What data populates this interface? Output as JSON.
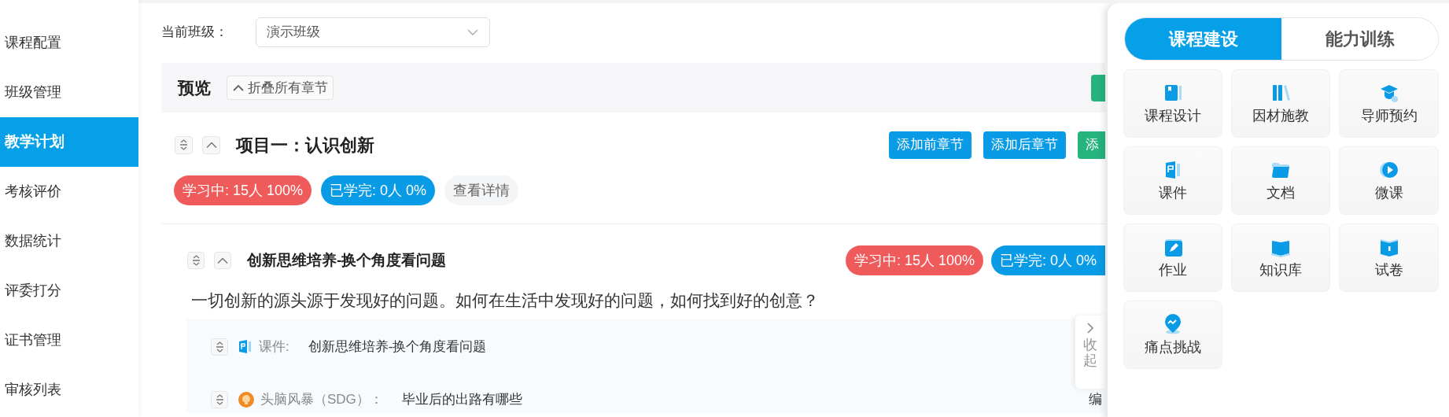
{
  "sidebar": {
    "items": [
      {
        "label": "课程配置",
        "selected": false
      },
      {
        "label": "班级管理",
        "selected": false
      },
      {
        "label": "教学计划",
        "selected": true
      },
      {
        "label": "考核评价",
        "selected": false
      },
      {
        "label": "数据统计",
        "selected": false
      },
      {
        "label": "评委打分",
        "selected": false
      },
      {
        "label": "证书管理",
        "selected": false
      },
      {
        "label": "审核列表",
        "selected": false
      }
    ]
  },
  "class_selector": {
    "label": "当前班级：",
    "value": "演示班级"
  },
  "preview": {
    "title": "预览",
    "collapse_all": "折叠所有章节"
  },
  "chapter": {
    "title": "项目一：认识创新",
    "buttons": [
      {
        "label": "添加前章节",
        "kind": "blue"
      },
      {
        "label": "添加后章节",
        "kind": "blue"
      },
      {
        "label": "添",
        "kind": "green"
      }
    ],
    "badges": [
      {
        "label": "学习中: 15人 100%",
        "kind": "learning"
      },
      {
        "label": "已学完: 0人 0%",
        "kind": "done"
      },
      {
        "label": "查看详情",
        "kind": "details"
      }
    ]
  },
  "section": {
    "title": "创新思维培养-换个角度看问题",
    "badges": [
      {
        "label": "学习中: 15人 100%",
        "kind": "learning"
      },
      {
        "label": "已学完: 0人 0%",
        "kind": "done"
      }
    ],
    "description": "一切创新的源头源于发现好的问题。如何在生活中发现好的问题，如何找到好的创意？",
    "resources": [
      {
        "kind": "courseware",
        "type_label": "课件:",
        "title": "创新思维培养-换个角度看问题"
      },
      {
        "kind": "brainstorm",
        "type_label": "头脑风暴（SDG）：",
        "title": "毕业后的出路有哪些",
        "action": "编"
      }
    ]
  },
  "collapse_tab": {
    "label": "收起"
  },
  "panel": {
    "tabs": [
      {
        "label": "课程建设",
        "selected": true
      },
      {
        "label": "能力训练",
        "selected": false
      }
    ],
    "tools": [
      {
        "label": "课程设计"
      },
      {
        "label": "因材施教"
      },
      {
        "label": "导师预约"
      },
      {
        "label": "课件"
      },
      {
        "label": "文档"
      },
      {
        "label": "微课"
      },
      {
        "label": "作业"
      },
      {
        "label": "知识库"
      },
      {
        "label": "试卷"
      },
      {
        "label": "痛点挑战"
      }
    ]
  }
}
